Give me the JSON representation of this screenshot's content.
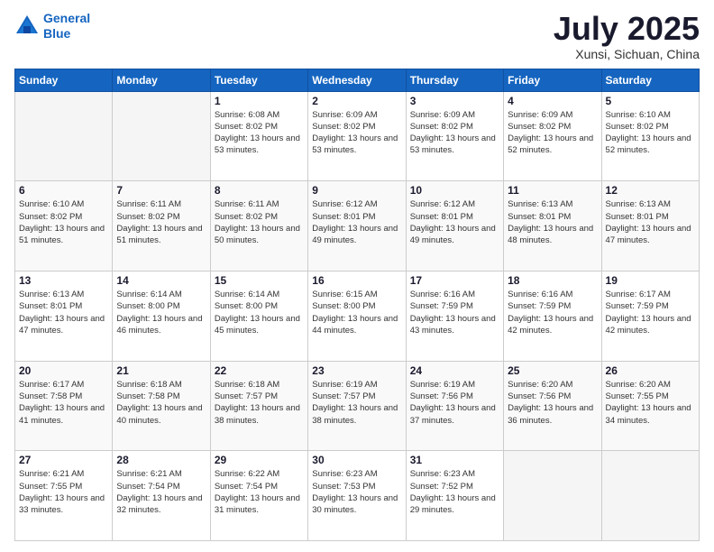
{
  "logo": {
    "line1": "General",
    "line2": "Blue"
  },
  "title": "July 2025",
  "location": "Xunsi, Sichuan, China",
  "weekdays": [
    "Sunday",
    "Monday",
    "Tuesday",
    "Wednesday",
    "Thursday",
    "Friday",
    "Saturday"
  ],
  "weeks": [
    [
      {
        "day": "",
        "sunrise": "",
        "sunset": "",
        "daylight": ""
      },
      {
        "day": "",
        "sunrise": "",
        "sunset": "",
        "daylight": ""
      },
      {
        "day": "1",
        "sunrise": "Sunrise: 6:08 AM",
        "sunset": "Sunset: 8:02 PM",
        "daylight": "Daylight: 13 hours and 53 minutes."
      },
      {
        "day": "2",
        "sunrise": "Sunrise: 6:09 AM",
        "sunset": "Sunset: 8:02 PM",
        "daylight": "Daylight: 13 hours and 53 minutes."
      },
      {
        "day": "3",
        "sunrise": "Sunrise: 6:09 AM",
        "sunset": "Sunset: 8:02 PM",
        "daylight": "Daylight: 13 hours and 53 minutes."
      },
      {
        "day": "4",
        "sunrise": "Sunrise: 6:09 AM",
        "sunset": "Sunset: 8:02 PM",
        "daylight": "Daylight: 13 hours and 52 minutes."
      },
      {
        "day": "5",
        "sunrise": "Sunrise: 6:10 AM",
        "sunset": "Sunset: 8:02 PM",
        "daylight": "Daylight: 13 hours and 52 minutes."
      }
    ],
    [
      {
        "day": "6",
        "sunrise": "Sunrise: 6:10 AM",
        "sunset": "Sunset: 8:02 PM",
        "daylight": "Daylight: 13 hours and 51 minutes."
      },
      {
        "day": "7",
        "sunrise": "Sunrise: 6:11 AM",
        "sunset": "Sunset: 8:02 PM",
        "daylight": "Daylight: 13 hours and 51 minutes."
      },
      {
        "day": "8",
        "sunrise": "Sunrise: 6:11 AM",
        "sunset": "Sunset: 8:02 PM",
        "daylight": "Daylight: 13 hours and 50 minutes."
      },
      {
        "day": "9",
        "sunrise": "Sunrise: 6:12 AM",
        "sunset": "Sunset: 8:01 PM",
        "daylight": "Daylight: 13 hours and 49 minutes."
      },
      {
        "day": "10",
        "sunrise": "Sunrise: 6:12 AM",
        "sunset": "Sunset: 8:01 PM",
        "daylight": "Daylight: 13 hours and 49 minutes."
      },
      {
        "day": "11",
        "sunrise": "Sunrise: 6:13 AM",
        "sunset": "Sunset: 8:01 PM",
        "daylight": "Daylight: 13 hours and 48 minutes."
      },
      {
        "day": "12",
        "sunrise": "Sunrise: 6:13 AM",
        "sunset": "Sunset: 8:01 PM",
        "daylight": "Daylight: 13 hours and 47 minutes."
      }
    ],
    [
      {
        "day": "13",
        "sunrise": "Sunrise: 6:13 AM",
        "sunset": "Sunset: 8:01 PM",
        "daylight": "Daylight: 13 hours and 47 minutes."
      },
      {
        "day": "14",
        "sunrise": "Sunrise: 6:14 AM",
        "sunset": "Sunset: 8:00 PM",
        "daylight": "Daylight: 13 hours and 46 minutes."
      },
      {
        "day": "15",
        "sunrise": "Sunrise: 6:14 AM",
        "sunset": "Sunset: 8:00 PM",
        "daylight": "Daylight: 13 hours and 45 minutes."
      },
      {
        "day": "16",
        "sunrise": "Sunrise: 6:15 AM",
        "sunset": "Sunset: 8:00 PM",
        "daylight": "Daylight: 13 hours and 44 minutes."
      },
      {
        "day": "17",
        "sunrise": "Sunrise: 6:16 AM",
        "sunset": "Sunset: 7:59 PM",
        "daylight": "Daylight: 13 hours and 43 minutes."
      },
      {
        "day": "18",
        "sunrise": "Sunrise: 6:16 AM",
        "sunset": "Sunset: 7:59 PM",
        "daylight": "Daylight: 13 hours and 42 minutes."
      },
      {
        "day": "19",
        "sunrise": "Sunrise: 6:17 AM",
        "sunset": "Sunset: 7:59 PM",
        "daylight": "Daylight: 13 hours and 42 minutes."
      }
    ],
    [
      {
        "day": "20",
        "sunrise": "Sunrise: 6:17 AM",
        "sunset": "Sunset: 7:58 PM",
        "daylight": "Daylight: 13 hours and 41 minutes."
      },
      {
        "day": "21",
        "sunrise": "Sunrise: 6:18 AM",
        "sunset": "Sunset: 7:58 PM",
        "daylight": "Daylight: 13 hours and 40 minutes."
      },
      {
        "day": "22",
        "sunrise": "Sunrise: 6:18 AM",
        "sunset": "Sunset: 7:57 PM",
        "daylight": "Daylight: 13 hours and 38 minutes."
      },
      {
        "day": "23",
        "sunrise": "Sunrise: 6:19 AM",
        "sunset": "Sunset: 7:57 PM",
        "daylight": "Daylight: 13 hours and 38 minutes."
      },
      {
        "day": "24",
        "sunrise": "Sunrise: 6:19 AM",
        "sunset": "Sunset: 7:56 PM",
        "daylight": "Daylight: 13 hours and 37 minutes."
      },
      {
        "day": "25",
        "sunrise": "Sunrise: 6:20 AM",
        "sunset": "Sunset: 7:56 PM",
        "daylight": "Daylight: 13 hours and 36 minutes."
      },
      {
        "day": "26",
        "sunrise": "Sunrise: 6:20 AM",
        "sunset": "Sunset: 7:55 PM",
        "daylight": "Daylight: 13 hours and 34 minutes."
      }
    ],
    [
      {
        "day": "27",
        "sunrise": "Sunrise: 6:21 AM",
        "sunset": "Sunset: 7:55 PM",
        "daylight": "Daylight: 13 hours and 33 minutes."
      },
      {
        "day": "28",
        "sunrise": "Sunrise: 6:21 AM",
        "sunset": "Sunset: 7:54 PM",
        "daylight": "Daylight: 13 hours and 32 minutes."
      },
      {
        "day": "29",
        "sunrise": "Sunrise: 6:22 AM",
        "sunset": "Sunset: 7:54 PM",
        "daylight": "Daylight: 13 hours and 31 minutes."
      },
      {
        "day": "30",
        "sunrise": "Sunrise: 6:23 AM",
        "sunset": "Sunset: 7:53 PM",
        "daylight": "Daylight: 13 hours and 30 minutes."
      },
      {
        "day": "31",
        "sunrise": "Sunrise: 6:23 AM",
        "sunset": "Sunset: 7:52 PM",
        "daylight": "Daylight: 13 hours and 29 minutes."
      },
      {
        "day": "",
        "sunrise": "",
        "sunset": "",
        "daylight": ""
      },
      {
        "day": "",
        "sunrise": "",
        "sunset": "",
        "daylight": ""
      }
    ]
  ]
}
